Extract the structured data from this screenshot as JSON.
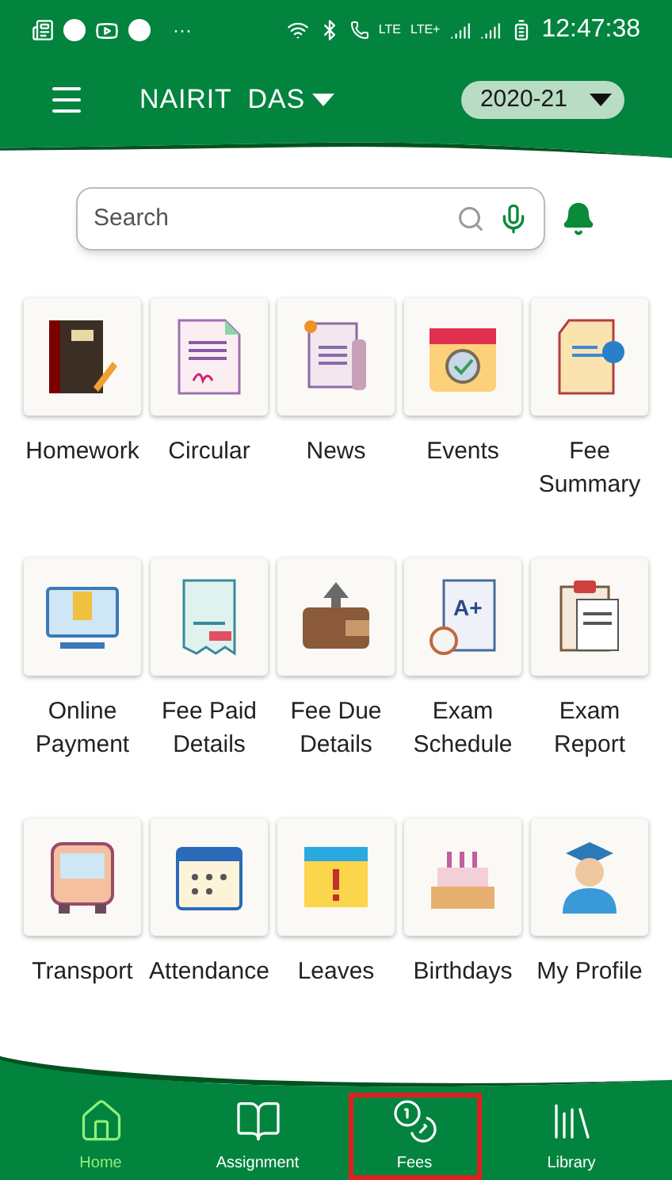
{
  "status_bar": {
    "overflow": "···",
    "network_labels": [
      "LTE",
      "LTE+"
    ],
    "time": "12:47:38"
  },
  "header": {
    "user_name": "NAIRIT  DAS",
    "session": "2020-21"
  },
  "search": {
    "placeholder": "Search"
  },
  "tiles": [
    {
      "label": "Homework"
    },
    {
      "label": "Circular"
    },
    {
      "label": "News"
    },
    {
      "label": "Events"
    },
    {
      "label": "Fee Summary"
    },
    {
      "label": "Online Payment"
    },
    {
      "label": "Fee Paid Details"
    },
    {
      "label": "Fee Due Details"
    },
    {
      "label": "Exam Schedule",
      "icon_text": "A+"
    },
    {
      "label": "Exam Report"
    },
    {
      "label": "Transport"
    },
    {
      "label": "Attendance"
    },
    {
      "label": "Leaves"
    },
    {
      "label": "Birthdays"
    },
    {
      "label": "My Profile"
    }
  ],
  "bottom_nav": [
    {
      "label": "Home",
      "selected": true,
      "highlighted": false
    },
    {
      "label": "Assignment",
      "selected": false,
      "highlighted": false
    },
    {
      "label": "Fees",
      "selected": false,
      "highlighted": true
    },
    {
      "label": "Library",
      "selected": false,
      "highlighted": false
    }
  ]
}
